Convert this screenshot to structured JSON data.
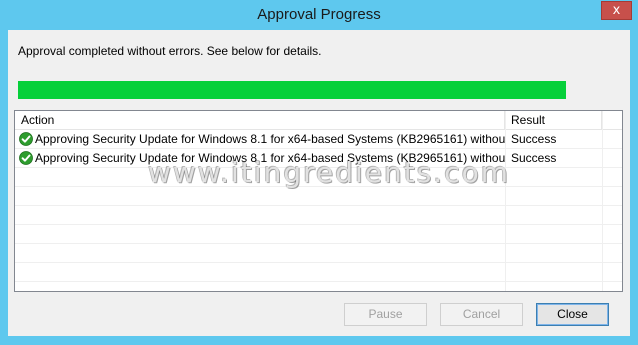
{
  "window": {
    "title": "Approval Progress",
    "close_glyph": "x"
  },
  "message": "Approval completed without errors. See below for details.",
  "progress": {
    "fraction": 1.0,
    "color": "#06d03a"
  },
  "table": {
    "columns": [
      "Action",
      "Result"
    ],
    "rows": [
      {
        "icon": "success-check-icon",
        "action": "Approving Security Update for Windows 8.1 for x64-based Systems (KB2965161) withou…",
        "result": "Success"
      },
      {
        "icon": "success-check-icon",
        "action": "Approving Security Update for Windows 8.1 for x64-based Systems (KB2965161) withou…",
        "result": "Success"
      }
    ],
    "empty_rows": 6
  },
  "watermark": "www.itingredients.com",
  "buttons": {
    "pause": "Pause",
    "cancel": "Cancel",
    "close": "Close"
  }
}
